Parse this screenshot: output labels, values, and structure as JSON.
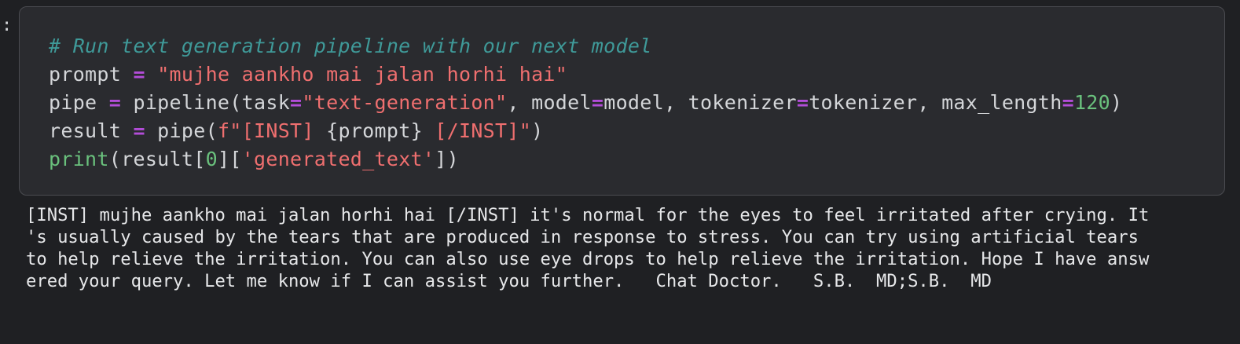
{
  "cell": {
    "prompt_marker": ":",
    "code_lines": [
      [
        {
          "t": "# Run text generation pipeline with our next model",
          "c": "comment"
        }
      ],
      [
        {
          "t": "prompt ",
          "c": "plain"
        },
        {
          "t": "=",
          "c": "op"
        },
        {
          "t": " ",
          "c": "plain"
        },
        {
          "t": "\"mujhe aankho mai jalan horhi hai\"",
          "c": "str"
        }
      ],
      [
        {
          "t": "pipe ",
          "c": "plain"
        },
        {
          "t": "=",
          "c": "op"
        },
        {
          "t": " pipeline(task",
          "c": "plain"
        },
        {
          "t": "=",
          "c": "op"
        },
        {
          "t": "\"text-generation\"",
          "c": "str"
        },
        {
          "t": ", model",
          "c": "plain"
        },
        {
          "t": "=",
          "c": "op"
        },
        {
          "t": "model, tokenizer",
          "c": "plain"
        },
        {
          "t": "=",
          "c": "op"
        },
        {
          "t": "tokenizer, max_length",
          "c": "plain"
        },
        {
          "t": "=",
          "c": "op"
        },
        {
          "t": "120",
          "c": "num"
        },
        {
          "t": ")",
          "c": "plain"
        }
      ],
      [
        {
          "t": "result ",
          "c": "plain"
        },
        {
          "t": "=",
          "c": "op"
        },
        {
          "t": " pipe(",
          "c": "plain"
        },
        {
          "t": "f\"[INST] ",
          "c": "str"
        },
        {
          "t": "{prompt}",
          "c": "plain"
        },
        {
          "t": " [/INST]\"",
          "c": "str"
        },
        {
          "t": ")",
          "c": "plain"
        }
      ],
      [
        {
          "t": "print",
          "c": "builtin"
        },
        {
          "t": "(result[",
          "c": "plain"
        },
        {
          "t": "0",
          "c": "num"
        },
        {
          "t": "][",
          "c": "plain"
        },
        {
          "t": "'generated_text'",
          "c": "str"
        },
        {
          "t": "])",
          "c": "plain"
        }
      ]
    ]
  },
  "output": {
    "lines": [
      "[INST] mujhe aankho mai jalan horhi hai [/INST] it's normal for the eyes to feel irritated after crying. It",
      "'s usually caused by the tears that are produced in response to stress. You can try using artificial tears",
      "to help relieve the irritation. You can also use eye drops to help relieve the irritation. Hope I have answ",
      "ered your query. Let me know if I can assist you further.   Chat Doctor.   S.B.  MD;S.B.  MD"
    ]
  },
  "colors": {
    "background": "#1f2023",
    "cell_background": "#2a2b2f",
    "comment": "#3f9a99",
    "operator": "#b34dd9",
    "string": "#ef6f6f",
    "number": "#6ac17d",
    "text": "#d4d6d9"
  }
}
